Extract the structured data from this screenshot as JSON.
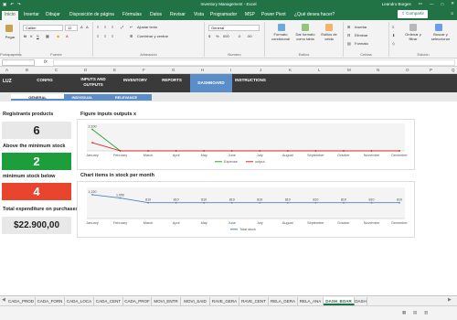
{
  "window": {
    "autosave_label": "",
    "title": "Inventory Management  -  Excel",
    "user": "Leandro Borges"
  },
  "ribbon_tabs": [
    "Inicio",
    "Insertar",
    "Dibujar",
    "Disposición de página",
    "Fórmulas",
    "Datos",
    "Revisar",
    "Vista",
    "Programador",
    "MSP",
    "Power Pivot",
    "¿Qué desea hacer?"
  ],
  "share_label": "Compartir",
  "ribbon": {
    "paste_label": "Pegar",
    "font_name": "Calibri",
    "font_size": "12",
    "wrap_text": "Ajustar texto",
    "merge_center": "Combinar y centrar",
    "number_format": "General",
    "cond_format": "Formato condicional",
    "format_table": "Dar formato como tabla",
    "cell_styles": "Estilos de celda",
    "insert": "Insertar",
    "delete": "Eliminar",
    "format": "Formato",
    "sort_filter": "Ordenar y filtrar",
    "find_select": "Buscar y seleccionar",
    "groups": {
      "clipboard": "Portapapeles",
      "font": "Fuente",
      "alignment": "Alineación",
      "number": "Número",
      "styles": "Estilos",
      "cells": "Celdas",
      "editing": "Edición"
    }
  },
  "formula_bar": {
    "name_box": "",
    "fx": "fx"
  },
  "columns": [
    "A",
    "B",
    "C",
    "D",
    "E",
    "F",
    "G",
    "H",
    "I",
    "J",
    "K",
    "L",
    "M",
    "N",
    "O",
    "P",
    "Q"
  ],
  "nav": {
    "logo_text": "LUZ",
    "items": [
      "CONFIG",
      "INPUTS AND OUTPUTS",
      "INVENTORY",
      "REPORTS",
      "DASHBOARD",
      "INSTRUCTIONS"
    ],
    "active_index": 4
  },
  "subnav": {
    "tabs": [
      "GENERAL",
      "INDIVIDUAL",
      "RELEVANCE"
    ],
    "active_index": 0
  },
  "kpis": [
    {
      "title": "Registrants products",
      "value": "6",
      "bg": "#e8e8e8",
      "fg": "#222222"
    },
    {
      "title": "Above the minimum stock",
      "value": "2",
      "bg": "#1e9e3a",
      "fg": "#ffffff"
    },
    {
      "title": "minimum stock below",
      "value": "4",
      "bg": "#e8442e",
      "fg": "#ffffff"
    },
    {
      "title": "Total expenditure on purchases",
      "value": "$22.900,00",
      "bg": "#e8e8e8",
      "fg": "#222222"
    }
  ],
  "chart_data": [
    {
      "type": "line",
      "title": "Figure inputs outputs x",
      "categories": [
        "January",
        "February",
        "March",
        "April",
        "May",
        "June",
        "July",
        "August",
        "September",
        "October",
        "November",
        "December"
      ],
      "series": [
        {
          "name": "Expense",
          "color": "#2ca02c",
          "values": [
            2100,
            0,
            0,
            0,
            0,
            0,
            0,
            0,
            0,
            0,
            0,
            0
          ]
        },
        {
          "name": "output",
          "color": "#d62728",
          "values": [
            800,
            0,
            0,
            0,
            0,
            0,
            0,
            0,
            0,
            0,
            0,
            0
          ]
        }
      ],
      "data_labels": [
        "2,100",
        "",
        "",
        "",
        "",
        "",
        "",
        "",
        "",
        "",
        "",
        ""
      ],
      "ylim": [
        0,
        2500
      ],
      "legend": "bottom"
    },
    {
      "type": "line",
      "title": "Chart items in stock per month",
      "categories": [
        "January",
        "February",
        "March",
        "April",
        "May",
        "June",
        "July",
        "August",
        "September",
        "October",
        "November",
        "December"
      ],
      "series": [
        {
          "name": "Total stock",
          "color": "#4f81bd",
          "values": [
            1220,
            1050,
            810,
            810,
            810,
            810,
            810,
            810,
            810,
            810,
            810,
            810
          ]
        }
      ],
      "data_labels": [
        "1,220",
        "1,050",
        "810",
        "810",
        "810",
        "810",
        "810",
        "810",
        "810",
        "810",
        "810",
        "810"
      ],
      "ylim": [
        0,
        1500
      ],
      "legend": "bottom"
    }
  ],
  "sheet_tabs": [
    "CADA_PROD",
    "CADA_FORN",
    "CADA_LOCA",
    "CADA_CENT",
    "CADA_PROF",
    "MOVI_ENTR",
    "MOVI_SAID",
    "RAVE_GERA",
    "RAVE_CENT",
    "RELA_GERA",
    "RELA_ANA",
    "DASH_BOAR",
    "DASH"
  ],
  "active_sheet_index": 11
}
